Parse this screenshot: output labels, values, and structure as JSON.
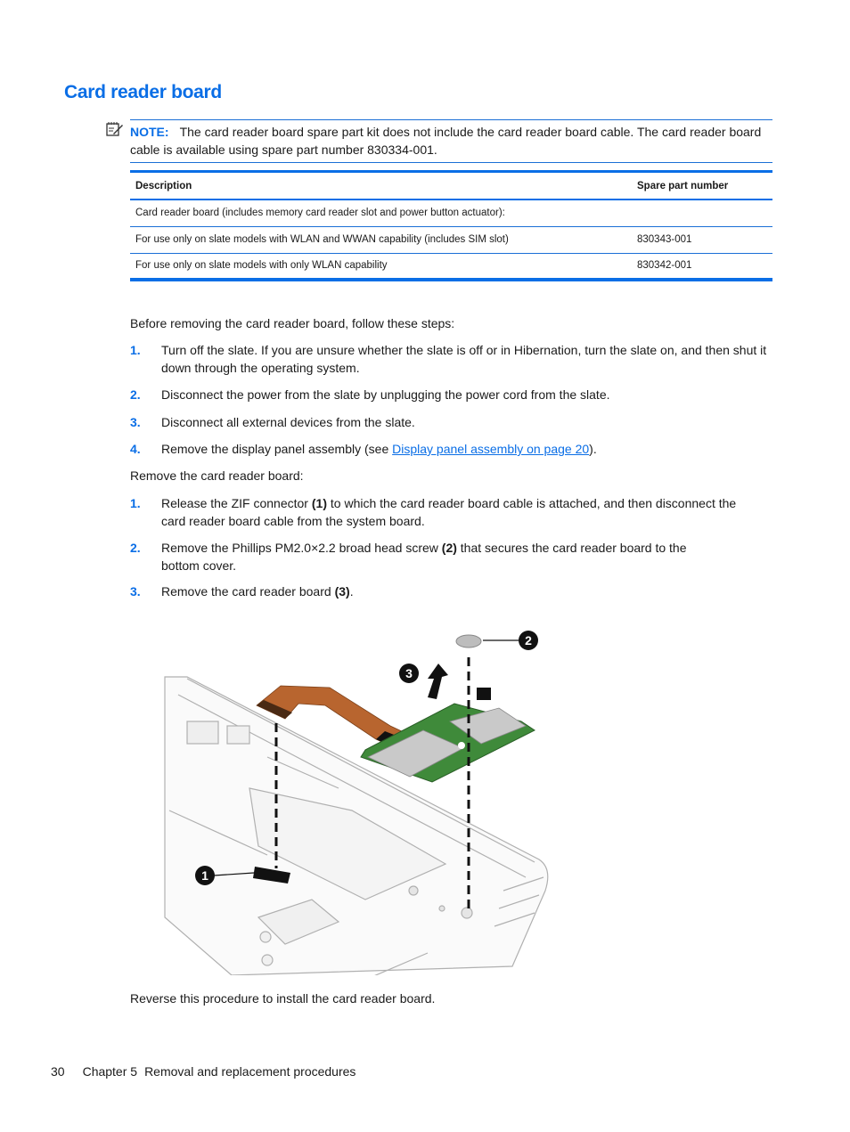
{
  "page": {
    "title": "Card reader board",
    "note": {
      "icon": "note-icon",
      "label": "NOTE:",
      "text": "The card reader board spare part kit does not include the card reader board cable. The card reader board cable is available using spare part number 830334-001."
    },
    "table": {
      "headers": [
        "Description",
        "Spare part number"
      ],
      "rows": [
        {
          "description": "Card reader board (includes memory card reader slot and power button actuator):",
          "part": ""
        },
        {
          "description": "For use only on slate models with WLAN and WWAN capability (includes SIM slot)",
          "part": "830343-001"
        },
        {
          "description": "For use only on slate models with only WLAN capability",
          "part": "830342-001"
        }
      ]
    },
    "before_intro": "Before removing the card reader board, follow these steps:",
    "before_steps": [
      {
        "num": "1.",
        "text": "Turn off the slate. If you are unsure whether the slate is off or in Hibernation, turn the slate on, and then shut it down through the operating system."
      },
      {
        "num": "2.",
        "text": "Disconnect the power from the slate by unplugging the power cord from the slate."
      },
      {
        "num": "3.",
        "text": "Disconnect all external devices from the slate."
      },
      {
        "num": "4.",
        "text_before": "Remove the display panel assembly (see ",
        "link": "Display panel assembly on page 20",
        "text_after": ")."
      }
    ],
    "remove_intro": "Remove the card reader board:",
    "remove_steps": [
      {
        "num": "1.",
        "text_before": "Release the ZIF connector ",
        "bold": "(1)",
        "text_after": " to which the card reader board cable is attached, and then disconnect the card reader board cable from the system board."
      },
      {
        "num": "2.",
        "text_before": "Remove the Phillips PM2.0×2.2 broad head screw ",
        "bold": "(2)",
        "text_after": " that secures the card reader board to the bottom cover."
      },
      {
        "num": "3.",
        "text_before": "Remove the card reader board ",
        "bold": "(3)",
        "text_after": "."
      }
    ],
    "figure": {
      "callouts": [
        "1",
        "2",
        "3"
      ]
    },
    "closing": "Reverse this procedure to install the card reader board.",
    "footer": {
      "page_number": "30",
      "chapter": "Chapter 5",
      "chapter_title": "Removal and replacement procedures"
    }
  },
  "colors": {
    "accent": "#0a6ee6",
    "text": "#1a1a1a",
    "board_green": "#3f8a3a",
    "cable_orange": "#b8652f"
  }
}
